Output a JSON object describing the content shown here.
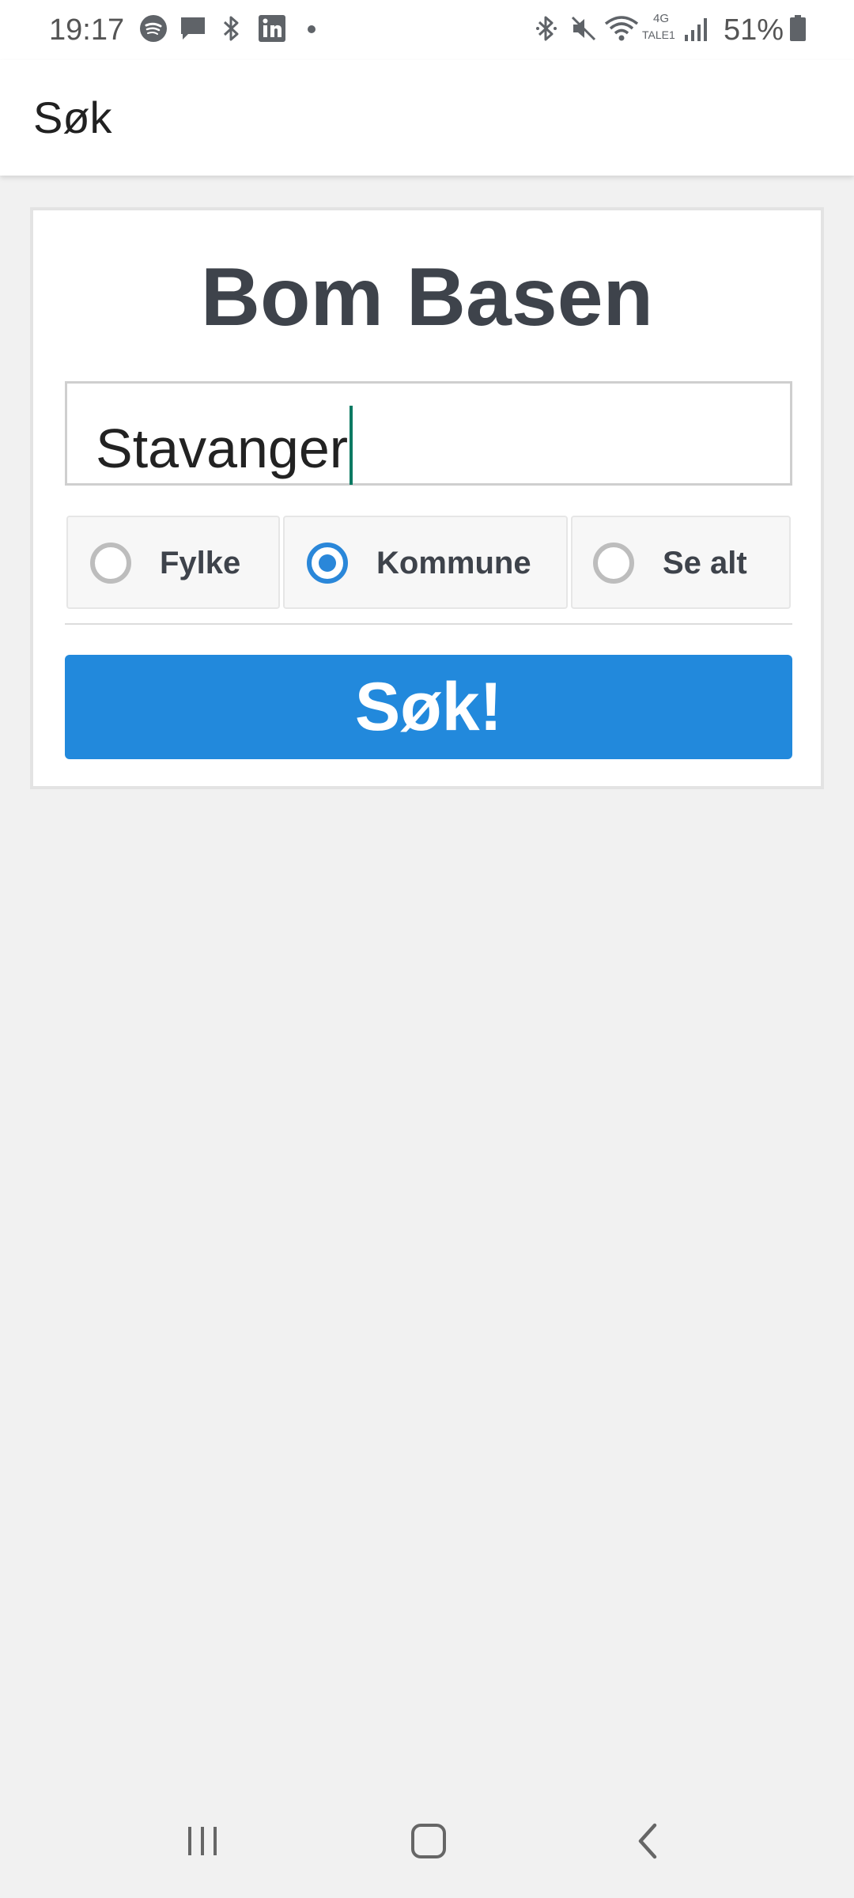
{
  "status_bar": {
    "time": "19:17",
    "network": "4G",
    "carrier": "TALE1",
    "battery": "51%",
    "icons_left": [
      "spotify-icon",
      "message-icon",
      "bluetooth-icon",
      "linkedin-icon",
      "dot-icon"
    ],
    "icons_right": [
      "bluetooth-icon",
      "mute-icon",
      "wifi-icon",
      "signal-icon",
      "battery-icon"
    ]
  },
  "app_bar": {
    "title": "Søk"
  },
  "card": {
    "title": "Bom Basen",
    "search": {
      "value": "Stavanger"
    },
    "radio_options": [
      {
        "label": "Fylke",
        "checked": false
      },
      {
        "label": "Kommune",
        "checked": true
      },
      {
        "label": "Se alt",
        "checked": false
      }
    ],
    "button_label": "Søk!"
  },
  "nav_bar": {
    "buttons": [
      "recents-icon",
      "home-icon",
      "back-icon"
    ]
  },
  "colors": {
    "accent": "#2289dc",
    "radio_checked": "#2a87d9",
    "caret": "#0b7a63",
    "title_text": "#3e434b",
    "background": "#f1f1f1"
  }
}
